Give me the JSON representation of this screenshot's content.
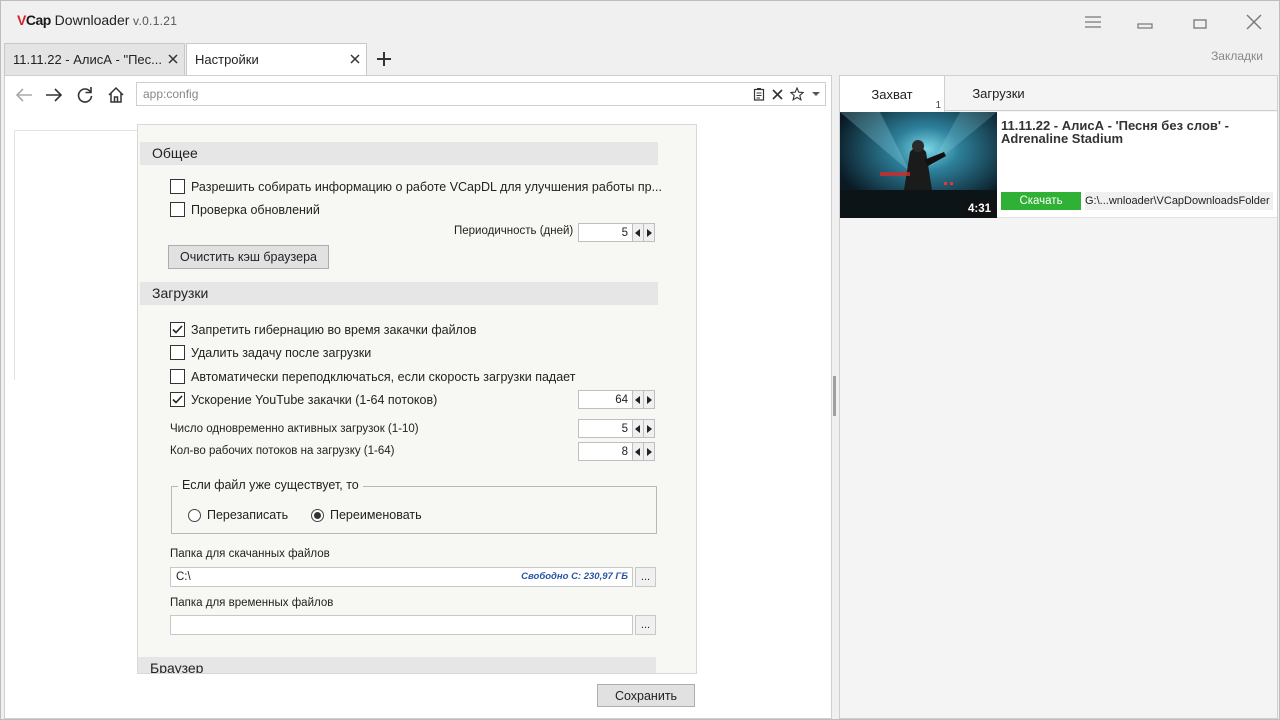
{
  "app": {
    "brand_v": "V",
    "brand_cap": "Cap",
    "brand_name": " Downloader",
    "version": " v.0.1.21"
  },
  "tabs": [
    {
      "label": "11.11.22 - АлисА - \"Пес..."
    },
    {
      "label": "Настройки"
    }
  ],
  "bookmarks_label": "Закладки",
  "address": {
    "value": "app:config"
  },
  "settings": {
    "general": {
      "title": "Общее",
      "allow_info": "Разрешить собирать информацию о работе VCapDL для улучшения работы пр...",
      "check_updates": "Проверка обновлений",
      "period_label": "Периодичность (дней)",
      "period_value": "5",
      "clear_cache": "Очистить кэш браузера"
    },
    "downloads": {
      "title": "Загрузки",
      "no_hibernate": "Запретить гибернацию во время закачки файлов",
      "no_hibernate_checked": true,
      "delete_task": "Удалить задачу после загрузки",
      "auto_reconnect": "Автоматически переподключаться, если скорость загрузки падает",
      "yt_accel": "Ускорение YouTube закачки (1-64 потоков)",
      "yt_accel_checked": true,
      "yt_threads": "64",
      "active_label": "Число одновременно активных загрузок (1-10)",
      "active_value": "5",
      "workers_label": "Кол-во рабочих потоков на загрузку (1-64)",
      "workers_value": "8",
      "exists_legend": "Если файл уже существует, то",
      "overwrite": "Перезаписать",
      "rename": "Переименовать",
      "selected": "rename",
      "folder_label": "Папка для скачанных файлов",
      "folder_value": "C:\\",
      "free_space": "Свободно C: 230,97 ГБ",
      "temp_label": "Папка для временных файлов",
      "temp_value": "",
      "browse": "..."
    },
    "browser": {
      "title": "Браузер"
    },
    "save": "Сохранить"
  },
  "right_panel": {
    "tab_capture": "Захват",
    "capture_count": "1",
    "tab_downloads": "Загрузки",
    "items": [
      {
        "title": "11.11.22 - АлисА - 'Песня без слов' - Adrenaline Stadium",
        "duration": "4:31",
        "download_label": "Скачать",
        "path": "G:\\...wnloader\\VCapDownloadsFolder"
      }
    ]
  },
  "colors": {
    "accent_green": "#2eb135",
    "brand_red": "#d8202a",
    "free_space_blue": "#2a55a5"
  }
}
